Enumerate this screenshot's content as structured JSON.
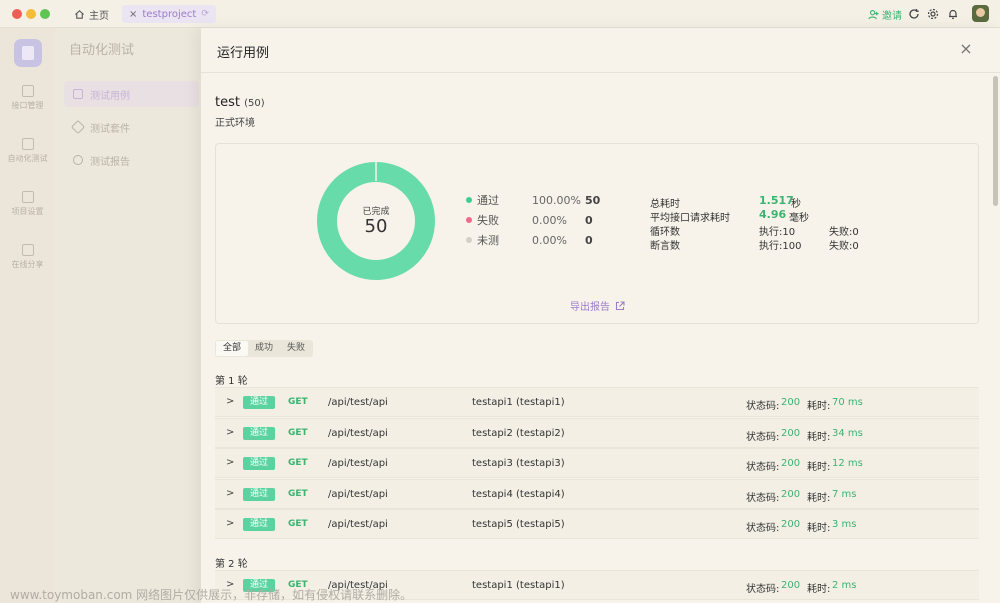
{
  "titlebar": {
    "home_tab": "主页",
    "project_tab": "testproject",
    "invite_label": "邀请"
  },
  "sidebar": {
    "items": [
      {
        "label": "接口管理",
        "icon": "api-icon"
      },
      {
        "label": "自动化测试",
        "icon": "automation-icon"
      },
      {
        "label": "项目设置",
        "icon": "settings-icon"
      },
      {
        "label": "在线分享",
        "icon": "share-icon"
      }
    ]
  },
  "subnav": {
    "title": "自动化测试",
    "items": [
      {
        "label": "测试用例",
        "active": true
      },
      {
        "label": "测试套件",
        "active": false
      },
      {
        "label": "测试报告",
        "active": false
      }
    ]
  },
  "drawer": {
    "title": "运行用例",
    "case_name": "test",
    "case_count": "(50)",
    "environment": "正式环境",
    "summary": {
      "donut_label": "已完成",
      "donut_value": "50",
      "legend": [
        {
          "name": "通过",
          "percent": "100.00%",
          "count": "50",
          "color": "#3ccf91"
        },
        {
          "name": "失败",
          "percent": "0.00%",
          "count": "0",
          "color": "#ef6a8a"
        },
        {
          "name": "未测",
          "percent": "0.00%",
          "count": "0",
          "color": "#d3cfc6"
        }
      ],
      "stats": {
        "total_time_label": "总耗时",
        "total_time_value": "1.517",
        "total_time_unit": "秒",
        "avg_time_label": "平均接口请求耗时",
        "avg_time_value": "4.96",
        "avg_time_unit": "毫秒",
        "loops_label": "循环数",
        "loops_exec": "执行:10",
        "loops_fail": "失败:0",
        "assert_label": "断言数",
        "assert_exec": "执行:100",
        "assert_fail": "失败:0"
      },
      "export_label": "导出报告"
    },
    "filters": [
      "全部",
      "成功",
      "失败"
    ],
    "rounds": [
      {
        "title": "第 1 轮",
        "rows": [
          {
            "status": "通过",
            "method": "GET",
            "path": "/api/test/api",
            "name": "testapi1 (testapi1)",
            "status_label": "状态码:",
            "status_code": "200",
            "time_label": "耗时:",
            "time": "70 ms"
          },
          {
            "status": "通过",
            "method": "GET",
            "path": "/api/test/api",
            "name": "testapi2 (testapi2)",
            "status_label": "状态码:",
            "status_code": "200",
            "time_label": "耗时:",
            "time": "34 ms"
          },
          {
            "status": "通过",
            "method": "GET",
            "path": "/api/test/api",
            "name": "testapi3 (testapi3)",
            "status_label": "状态码:",
            "status_code": "200",
            "time_label": "耗时:",
            "time": "12 ms"
          },
          {
            "status": "通过",
            "method": "GET",
            "path": "/api/test/api",
            "name": "testapi4 (testapi4)",
            "status_label": "状态码:",
            "status_code": "200",
            "time_label": "耗时:",
            "time": "7 ms"
          },
          {
            "status": "通过",
            "method": "GET",
            "path": "/api/test/api",
            "name": "testapi5 (testapi5)",
            "status_label": "状态码:",
            "status_code": "200",
            "time_label": "耗时:",
            "time": "3 ms"
          }
        ]
      },
      {
        "title": "第 2 轮",
        "rows": [
          {
            "status": "通过",
            "method": "GET",
            "path": "/api/test/api",
            "name": "testapi1 (testapi1)",
            "status_label": "状态码:",
            "status_code": "200",
            "time_label": "耗时:",
            "time": "2 ms"
          }
        ]
      }
    ]
  },
  "watermark": "www.toymoban.com 网络图片仅供展示，非存储，如有侵权请联系删除。"
}
